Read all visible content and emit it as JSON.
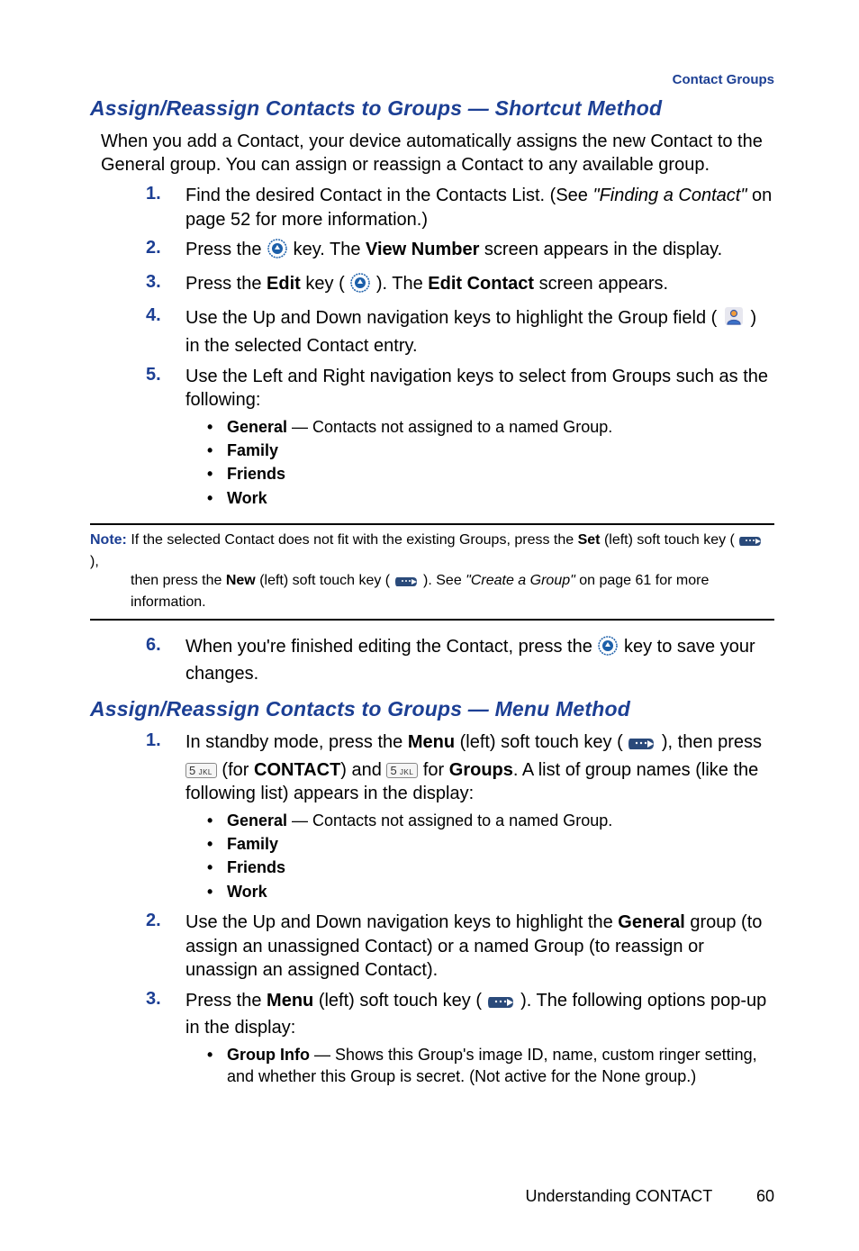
{
  "header": {
    "section_label": "Contact Groups"
  },
  "section1": {
    "title": "Assign/Reassign Contacts to Groups — Shortcut Method",
    "intro": "When you add a Contact, your device automatically assigns the new Contact to the General group. You can assign or reassign a Contact to any available group.",
    "steps": [
      {
        "num": "1.",
        "pre": "Find the desired Contact in the Contacts List. (See ",
        "italic": "\"Finding a Contact\"",
        "post": " on page 52 for more information.)"
      },
      {
        "num": "2.",
        "pre": "Press the ",
        "mid1": " key. The ",
        "bold1": "View Number",
        "post": " screen appears in the display."
      },
      {
        "num": "3.",
        "pre": "Press the ",
        "bold1": "Edit",
        "mid1": " key ( ",
        "mid2": " ). The ",
        "bold2": "Edit Contact",
        "post": " screen appears."
      },
      {
        "num": "4.",
        "pre": "Use the Up and Down navigation keys to highlight the Group field ( ",
        "post": " ) in the selected Contact entry."
      },
      {
        "num": "5.",
        "pre": "Use the Left and Right navigation keys to select from Groups such as the following:",
        "bullets": [
          {
            "bold": "General",
            "rest": " — Contacts not assigned to a named Group."
          },
          {
            "bold": "Family",
            "rest": ""
          },
          {
            "bold": "Friends",
            "rest": ""
          },
          {
            "bold": "Work",
            "rest": ""
          }
        ]
      }
    ],
    "note": {
      "label": "Note: ",
      "line1_pre": "If the selected Contact does not fit with the existing Groups, press the ",
      "line1_bold1": "Set",
      "line1_mid1": " (left) soft touch key ( ",
      "line1_post1": " ), ",
      "line2_pre": "then press the ",
      "line2_bold1": "New",
      "line2_mid1": " (left) soft touch key ( ",
      "line2_mid2": " ). See ",
      "line2_italic": "\"Create a Group\"",
      "line2_post": " on page 61 for more ",
      "line3": "information."
    },
    "step6": {
      "num": "6.",
      "pre": "When you're finished editing the Contact, press the ",
      "post": " key to save your changes."
    }
  },
  "section2": {
    "title": "Assign/Reassign Contacts to Groups — Menu Method",
    "step1": {
      "num": "1.",
      "pre": "In standby mode, press the ",
      "bold1": "Menu",
      "mid1": " (left) soft touch key ( ",
      "mid2": " ), then press ",
      "key1": "5",
      "key1_letters": "JKL",
      "mid3": " (for ",
      "bold2": "CONTACT",
      "mid4": ") and ",
      "key2": "5",
      "key2_letters": "JKL",
      "mid5": " for ",
      "bold3": "Groups",
      "post": ". A list of group names (like the following list) appears in the display:",
      "bullets": [
        {
          "bold": "General",
          "rest": " — Contacts not assigned to a named Group."
        },
        {
          "bold": "Family",
          "rest": ""
        },
        {
          "bold": "Friends",
          "rest": ""
        },
        {
          "bold": "Work",
          "rest": ""
        }
      ]
    },
    "step2": {
      "num": "2.",
      "pre": "Use the Up and Down navigation keys to highlight the ",
      "bold1": "General",
      "post": " group (to assign an unassigned Contact) or a named Group (to reassign or unassign an assigned Contact)."
    },
    "step3": {
      "num": "3.",
      "pre": "Press the ",
      "bold1": "Menu",
      "mid1": " (left) soft touch key ( ",
      "post": " ). The following options pop-up in the display:",
      "bullets": [
        {
          "bold": "Group Info",
          "rest": " — Shows this Group's image ID, name, custom ringer setting, and whether this Group is secret. (Not active for the None group.)"
        }
      ]
    }
  },
  "footer": {
    "title": "Understanding CONTACT",
    "page": "60"
  }
}
